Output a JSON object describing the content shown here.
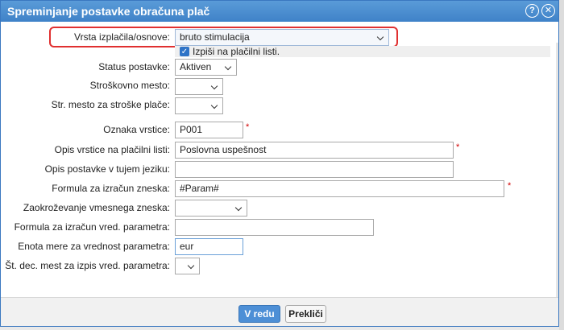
{
  "dialog": {
    "title": "Spreminjanje postavke obračuna plač",
    "help_icon": "help-icon",
    "close_icon": "close-icon"
  },
  "form": {
    "vrsta_label": "Vrsta izplačila/osnove:",
    "vrsta_value": "bruto stimulacija",
    "print_checkbox_label": "Izpiši na plačilni listi.",
    "print_checked": true,
    "status_label": "Status postavke:",
    "status_value": "Aktiven",
    "cost_center_label": "Stroškovno mesto:",
    "cost_center_value": "",
    "cost_center_salary_label": "Str. mesto za stroške plače:",
    "cost_center_salary_value": "",
    "row_code_label": "Oznaka vrstice:",
    "row_code_value": "P001",
    "row_desc_label": "Opis vrstice na plačilni listi:",
    "row_desc_value": "Poslovna uspešnost",
    "foreign_desc_label": "Opis postavke v tujem jeziku:",
    "foreign_desc_value": "",
    "formula_label": "Formula za izračun zneska:",
    "formula_value": "#Param#",
    "rounding_label": "Zaokroževanje vmesnega zneska:",
    "rounding_value": "",
    "param_formula_label": "Formula za izračun vred. parametra:",
    "param_formula_value": "",
    "unit_label": "Enota mere za vrednost parametra:",
    "unit_value": "eur",
    "decimals_label": "Št. dec. mest za izpis vred. parametra:",
    "decimals_value": "",
    "required_mark": "*"
  },
  "footer": {
    "ok_label": "V redu",
    "cancel_label": "Prekliči"
  }
}
